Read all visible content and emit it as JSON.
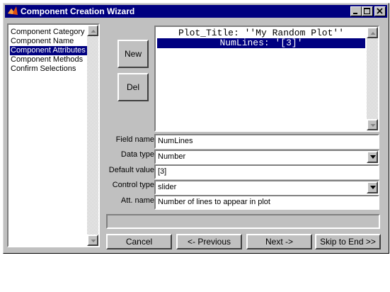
{
  "window": {
    "title": "Component Creation Wizard",
    "controls": [
      "minimize-icon",
      "maximize-icon",
      "close-icon"
    ]
  },
  "steps": {
    "items": [
      "Component Category",
      "Component Name",
      "Component Attributes",
      "Component Methods",
      "Confirm Selections"
    ],
    "selected_index": 2
  },
  "side_buttons": {
    "new_label": "New",
    "del_label": "Del"
  },
  "attributes": {
    "items": [
      "Plot_Title: ''My Random Plot''",
      "NumLines: '[3]'"
    ],
    "selected_index": 1
  },
  "form": {
    "field_name_label": "Field name",
    "field_name_value": "NumLines",
    "data_type_label": "Data type",
    "data_type_value": "Number",
    "default_value_label": "Default value",
    "default_value_value": "[3]",
    "control_type_label": "Control type",
    "control_type_value": "slider",
    "att_name_label": "Att. name",
    "att_name_value": "Number of lines to appear in plot"
  },
  "status_text": "",
  "nav": {
    "cancel_label": "Cancel",
    "previous_label": "<- Previous",
    "next_label": "Next ->",
    "skip_label": "Skip to End >>"
  },
  "colors": {
    "titlebar": "#000080",
    "face": "#c0c0c0",
    "selection": "#000080"
  }
}
